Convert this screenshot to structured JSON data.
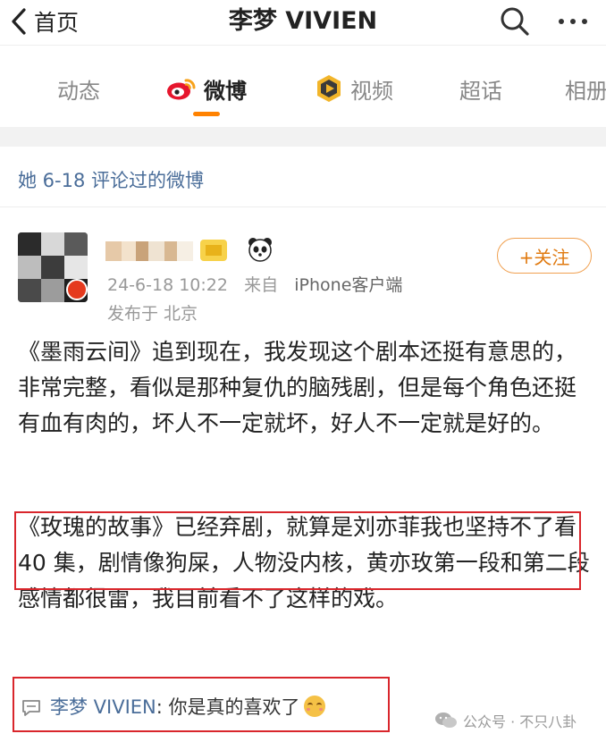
{
  "nav": {
    "back_label": "首页",
    "title": "李梦 VIVIEN",
    "search_icon": "search-icon",
    "more_icon": "more-icon"
  },
  "tabs": [
    {
      "label": "动态",
      "active": false
    },
    {
      "label": "微博",
      "active": true,
      "icon": "weibo-logo-icon"
    },
    {
      "label": "视频",
      "active": false,
      "icon": "video-badge-icon"
    },
    {
      "label": "超话",
      "active": false
    },
    {
      "label": "相册",
      "active": false
    }
  ],
  "section": {
    "title": "她 6-18 评论过的微博"
  },
  "post": {
    "timestamp": "24-6-18 10:22",
    "source_prefix": "来自",
    "source": "iPhone客户端",
    "location": "发布于 北京",
    "follow_label": "+关注",
    "paragraph1": "《墨雨云间》追到现在，我发现这个剧本还挺有意思的，非常完整，看似是那种复仇的脑残剧，但是每个角色还挺有血有肉的，坏人不一定就坏，好人不一定就是好的。",
    "paragraph2": "《玫瑰的故事》已经弃剧，就算是刘亦菲我也坚持不了看 40 集，剧情像狗屎，人物没内核，黄亦玫第一段和第二段感情都很雷，我目前看不了这样的戏。"
  },
  "comment": {
    "user": "李梦 VIVIEN",
    "separator": ":",
    "text": " 你是真的喜欢了",
    "emoji": "smile-emoji-icon"
  },
  "watermark": {
    "text": "公众号 · 不只八卦"
  },
  "colors": {
    "accent_orange": "#ff8200",
    "link_blue": "#4a6d99",
    "highlight_red": "#d9262c"
  }
}
